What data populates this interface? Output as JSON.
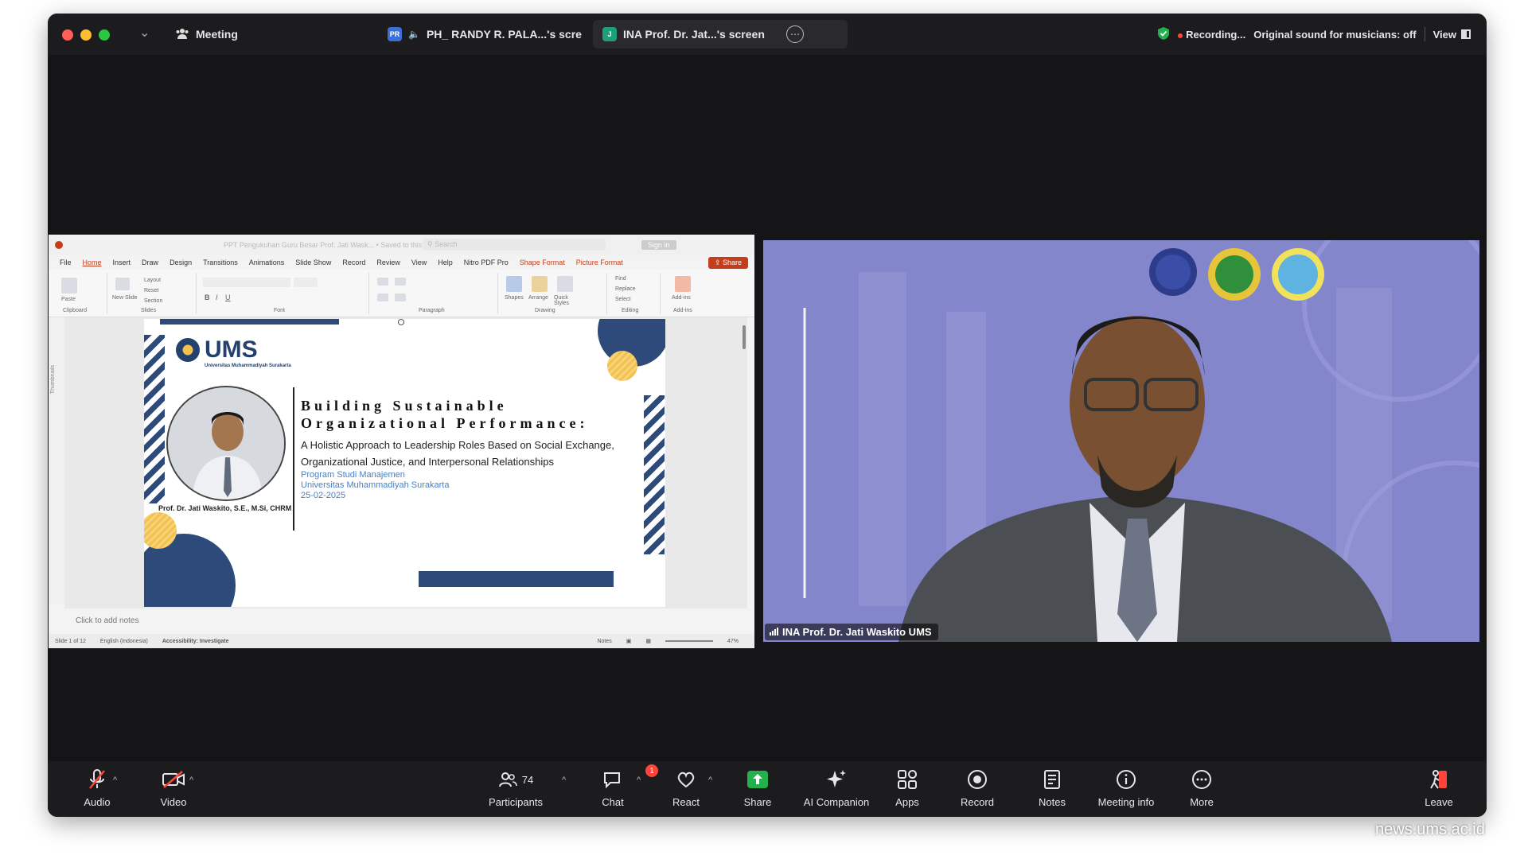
{
  "titlebar": {
    "meeting_label": "Meeting",
    "tab1_label": "PH_ RANDY R. PALA...'s scre",
    "tab2_label": "INA Prof. Dr. Jat...'s screen",
    "recording_label": "Recording...",
    "original_sound_label": "Original sound for musicians: off",
    "view_label": "View"
  },
  "ppt": {
    "window_title": "PPT Pengukuhan Guru Besar Prof. Jati Wask... • Saved to this PC",
    "search_placeholder": "Search",
    "signin_label": "Sign in",
    "menu": [
      "File",
      "Home",
      "Insert",
      "Draw",
      "Design",
      "Transitions",
      "Animations",
      "Slide Show",
      "Record",
      "Review",
      "View",
      "Help",
      "Nitro PDF Pro",
      "Shape Format",
      "Picture Format"
    ],
    "share_label": "Share",
    "ribbon_groups": [
      "Clipboard",
      "Slides",
      "Font",
      "Paragraph",
      "Drawing",
      "Editing",
      "Add-ins"
    ],
    "ribbon_items": {
      "paste": "Paste",
      "new_slide": "New Slide",
      "layout": "Layout",
      "reset": "Reset",
      "section": "Section",
      "shapes": "Shapes",
      "arrange": "Arrange",
      "quick_styles": "Quick Styles",
      "find": "Find",
      "replace": "Replace",
      "select": "Select",
      "addins": "Add-ins"
    },
    "thumbnails_label": "Thumbnails",
    "notes_placeholder": "Click to add notes",
    "status": {
      "slide": "Slide 1 of 12",
      "language": "English (Indonesia)",
      "accessibility": "Accessibility: Investigate",
      "notes": "Notes",
      "zoom": "47%"
    }
  },
  "slide": {
    "logo_text": "UMS",
    "logo_sub": "Universitas Muhammadiyah Surakarta",
    "title_line1": "Building Sustainable",
    "title_line2": "Organizational Performance:",
    "subtitle": "A Holistic Approach to Leadership Roles Based on Social Exchange, Organizational Justice, and Interpersonal Relationships",
    "dept_line1": "Program Studi Manajemen",
    "dept_line2": "Universitas Muhammadiyah Surakarta",
    "date": "25-02-2025",
    "speaker_name": "Prof. Dr. Jati Waskito, S.E., M.Si, CHRM"
  },
  "video": {
    "participant_name": "INA Prof. Dr. Jati Waskito UMS"
  },
  "toolbar": {
    "audio": "Audio",
    "video": "Video",
    "participants": "Participants",
    "participants_count": "74",
    "chat": "Chat",
    "chat_badge": "1",
    "react": "React",
    "share": "Share",
    "ai_companion": "AI Companion",
    "apps": "Apps",
    "record": "Record",
    "notes": "Notes",
    "meeting_info": "Meeting info",
    "more": "More",
    "leave": "Leave"
  },
  "watermark": "news.ums.ac.id",
  "colors": {
    "window_bg": "#151518",
    "toolbar_bg": "#1c1c1f",
    "share_green": "#22b14c",
    "ppt_accent": "#c43e1c",
    "slide_navy": "#2e4a7a",
    "slide_gold": "#f2c14e",
    "video_bg": "#8b8dd0",
    "recording_red": "#ff453a"
  }
}
